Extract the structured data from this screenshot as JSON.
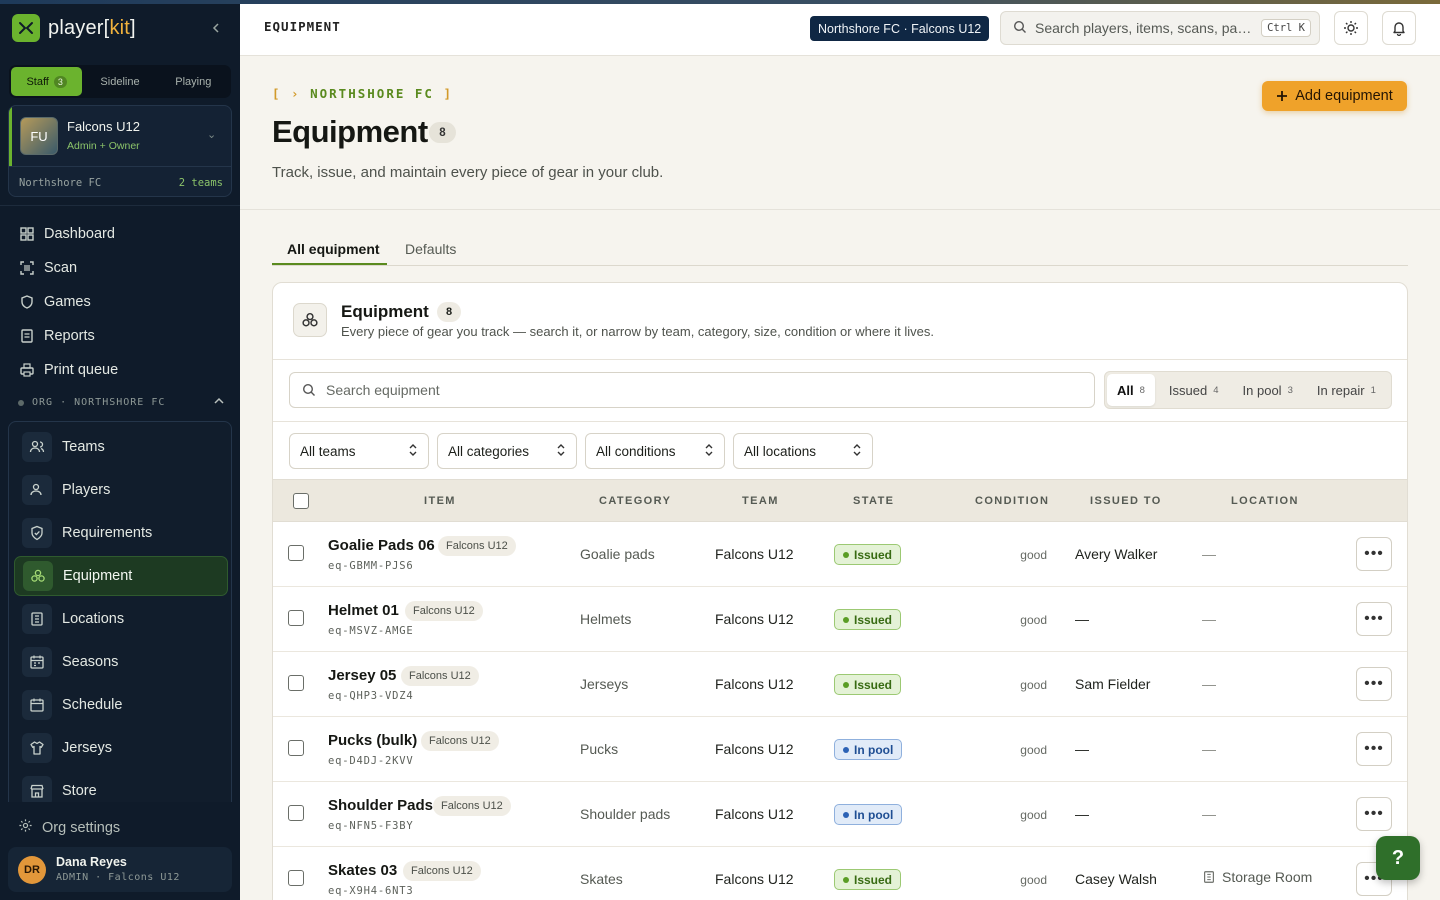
{
  "brand": {
    "name_main": "player[",
    "name_accent": "kit",
    "name_end": "]"
  },
  "sidebar": {
    "mode_tabs": [
      {
        "label": "Staff",
        "count": "3"
      },
      {
        "label": "Sideline"
      },
      {
        "label": "Playing"
      }
    ],
    "team": {
      "initials": "FU",
      "name": "Falcons U12",
      "role": "Admin + Owner",
      "org": "Northshore FC",
      "teams_count": "2 teams"
    },
    "nav": [
      {
        "label": "Dashboard",
        "icon": "dashboard-icon"
      },
      {
        "label": "Scan",
        "icon": "scan-icon"
      },
      {
        "label": "Games",
        "icon": "shield-icon"
      },
      {
        "label": "Reports",
        "icon": "reports-icon"
      },
      {
        "label": "Print queue",
        "icon": "printer-icon"
      }
    ],
    "org_section_label": "ORG · NORTHSHORE FC",
    "org_items": [
      {
        "label": "Teams",
        "icon": "users-icon"
      },
      {
        "label": "Players",
        "icon": "user-icon"
      },
      {
        "label": "Requirements",
        "icon": "shield-check-icon"
      },
      {
        "label": "Equipment",
        "icon": "equipment-icon",
        "active": true
      },
      {
        "label": "Locations",
        "icon": "building-icon"
      },
      {
        "label": "Seasons",
        "icon": "calendar-icon"
      },
      {
        "label": "Schedule",
        "icon": "calendar-icon"
      },
      {
        "label": "Jerseys",
        "icon": "jersey-icon"
      },
      {
        "label": "Store",
        "icon": "store-icon"
      }
    ],
    "settings_label": "Org settings",
    "user": {
      "initials": "DR",
      "name": "Dana Reyes",
      "role": "ADMIN · Falcons U12"
    }
  },
  "topbar": {
    "breadcrumb": "EQUIPMENT",
    "context_badge": "Northshore FC · Falcons U12",
    "search_placeholder": "Search players, items, scans, pag...",
    "search_shortcut": "Ctrl K"
  },
  "header": {
    "eyebrow_open": "[ ›",
    "eyebrow_text": "NORTHSHORE FC",
    "eyebrow_close": "]",
    "title": "Equipment",
    "count": "8",
    "subtitle": "Track, issue, and maintain every piece of gear in your club.",
    "add_button": "Add equipment"
  },
  "tabs": [
    {
      "label": "All equipment",
      "active": true
    },
    {
      "label": "Defaults"
    }
  ],
  "card": {
    "title": "Equipment",
    "count": "8",
    "subtitle": "Every piece of gear you track — search it, or narrow by team, category, size, condition or where it lives.",
    "search_placeholder": "Search equipment",
    "segments": [
      {
        "label": "All",
        "count": "8",
        "active": true
      },
      {
        "label": "Issued",
        "count": "4"
      },
      {
        "label": "In pool",
        "count": "3"
      },
      {
        "label": "In repair",
        "count": "1"
      }
    ],
    "filters": [
      "All teams",
      "All categories",
      "All conditions",
      "All locations"
    ],
    "columns": [
      "ITEM",
      "CATEGORY",
      "TEAM",
      "STATE",
      "CONDITION",
      "ISSUED TO",
      "LOCATION"
    ],
    "rows": [
      {
        "name": "Goalie Pads 06",
        "chip": "Falcons U12",
        "id": "eq-GBMM-PJS6",
        "category": "Goalie pads",
        "team": "Falcons U12",
        "state": "Issued",
        "condition": "good",
        "issued_to": "Avery Walker",
        "location": "—"
      },
      {
        "name": "Helmet 01",
        "chip": "Falcons U12",
        "id": "eq-MSVZ-AMGE",
        "category": "Helmets",
        "team": "Falcons U12",
        "state": "Issued",
        "condition": "good",
        "issued_to": "—",
        "location": "—"
      },
      {
        "name": "Jersey 05",
        "chip": "Falcons U12",
        "id": "eq-QHP3-VDZ4",
        "category": "Jerseys",
        "team": "Falcons U12",
        "state": "Issued",
        "condition": "good",
        "issued_to": "Sam Fielder",
        "location": "—"
      },
      {
        "name": "Pucks (bulk)",
        "chip": "Falcons U12",
        "id": "eq-D4DJ-2KVV",
        "category": "Pucks",
        "team": "Falcons U12",
        "state": "In pool",
        "condition": "good",
        "issued_to": "—",
        "location": "—"
      },
      {
        "name": "Shoulder Pads",
        "chip": "Falcons U12",
        "id": "eq-NFN5-F3BY",
        "category": "Shoulder pads",
        "team": "Falcons U12",
        "state": "In pool",
        "condition": "good",
        "issued_to": "—",
        "location": "—"
      },
      {
        "name": "Skates 03",
        "chip": "Falcons U12",
        "id": "eq-X9H4-6NT3",
        "category": "Skates",
        "team": "Falcons U12",
        "state": "Issued",
        "condition": "good",
        "issued_to": "Casey Walsh",
        "location": "Storage Room"
      }
    ]
  },
  "help_label": "?"
}
